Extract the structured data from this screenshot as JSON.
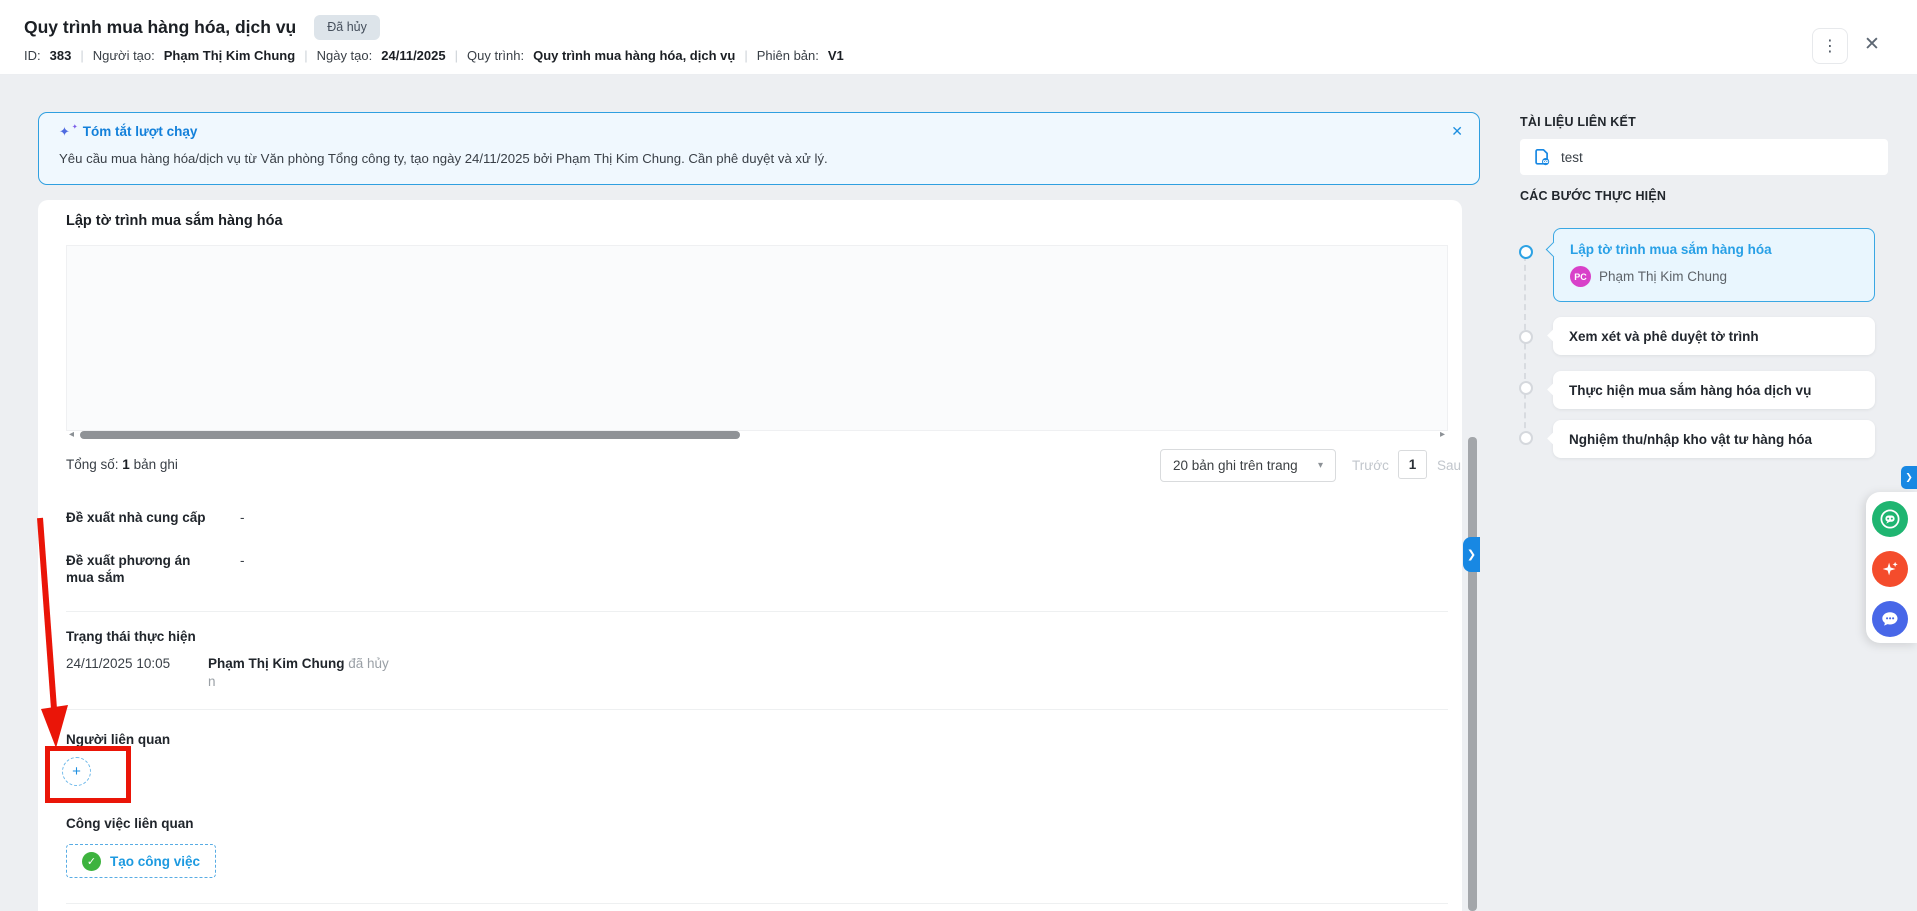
{
  "window": {
    "title": "Quy trình mua hàng hóa, dịch vụ",
    "status_badge": "Đã hủy",
    "meta_separator": "|",
    "meta_items": [
      {
        "label": "ID:",
        "value": "383"
      },
      {
        "label": "Người tạo:",
        "value": "Phạm Thị Kim Chung"
      },
      {
        "label": "Ngày tạo:",
        "value": "24/11/2025"
      },
      {
        "label": "Quy trình:",
        "value": "Quy trình mua hàng hóa, dịch vụ"
      },
      {
        "label": "Phiên bản:",
        "value": "V1"
      }
    ],
    "icons": {
      "kebab": "⋮",
      "close": "✕"
    }
  },
  "summary": {
    "icon": "✦",
    "icon_small": "✦",
    "title": "Tóm tắt lượt chạy",
    "close_icon": "✕",
    "body": "Yêu cầu mua hàng hóa/dịch vụ từ Văn phòng Tổng công ty, tạo ngày 24/11/2025 bởi Phạm Thị Kim Chung. Cần phê duyệt và xử lý."
  },
  "step_detail": {
    "title": "Lập tờ trình mua sắm hàng hóa",
    "scroll": {
      "left_arrow": "◂",
      "right_arrow": "▸"
    },
    "pagination": {
      "total_label": "Tổng số:",
      "total_value": "1",
      "total_unit": "bản ghi",
      "page_size_label": "20 bản ghi trên trang",
      "caret_icon": "▾",
      "prev_label": "Trước",
      "current_page": "1",
      "next_label": "Sau"
    },
    "fields": [
      {
        "label": "Đề xuất nhà cung cấp",
        "value": "-"
      },
      {
        "label": "Đề xuất phương án mua sắm",
        "value": "-"
      }
    ],
    "status": {
      "title": "Trạng thái thực hiện",
      "time": "24/11/2025 10:05",
      "actor": "Phạm Thị Kim Chung",
      "action": "đã hủy",
      "action_wrap": "n"
    },
    "people": {
      "title": "Người liên quan",
      "add_icon": "+"
    },
    "tasks": {
      "title": "Công việc liên quan",
      "check_icon": "✓",
      "create_label": "Tạo công việc"
    }
  },
  "sidebar": {
    "documents": {
      "title": "TÀI LIỆU LIÊN KẾT",
      "items": [
        {
          "name": "test"
        }
      ]
    },
    "steps": {
      "title": "CÁC BƯỚC THỰC HIỆN",
      "items": [
        {
          "label": "Lập tờ trình mua sắm hàng hóa",
          "state": "active",
          "avatar": "PC",
          "assignee": "Phạm Thị Kim Chung"
        },
        {
          "label": "Xem xét và phê duyệt tờ trình",
          "state": "pending"
        },
        {
          "label": "Thực hiện mua sắm hàng hóa dịch vụ",
          "state": "pending"
        },
        {
          "label": "Nghiệm thu/nhập kho vật tư hàng hóa",
          "state": "pending"
        }
      ]
    }
  },
  "floating": {
    "card_expand_icon": "❯",
    "screen_expand_icon": "❯"
  },
  "colors": {
    "accent_blue": "#1888e3",
    "summary_border": "#2f9fe0",
    "summary_bg": "#f0f8fe",
    "annotation_red": "#ea1508",
    "task_green": "#3db33e",
    "avatar_pink": "#d841c9",
    "support_green": "#1fb571",
    "ai_orange": "#f44c2c",
    "chat_blue": "#4867e8",
    "page_bg": "#edeff2"
  }
}
